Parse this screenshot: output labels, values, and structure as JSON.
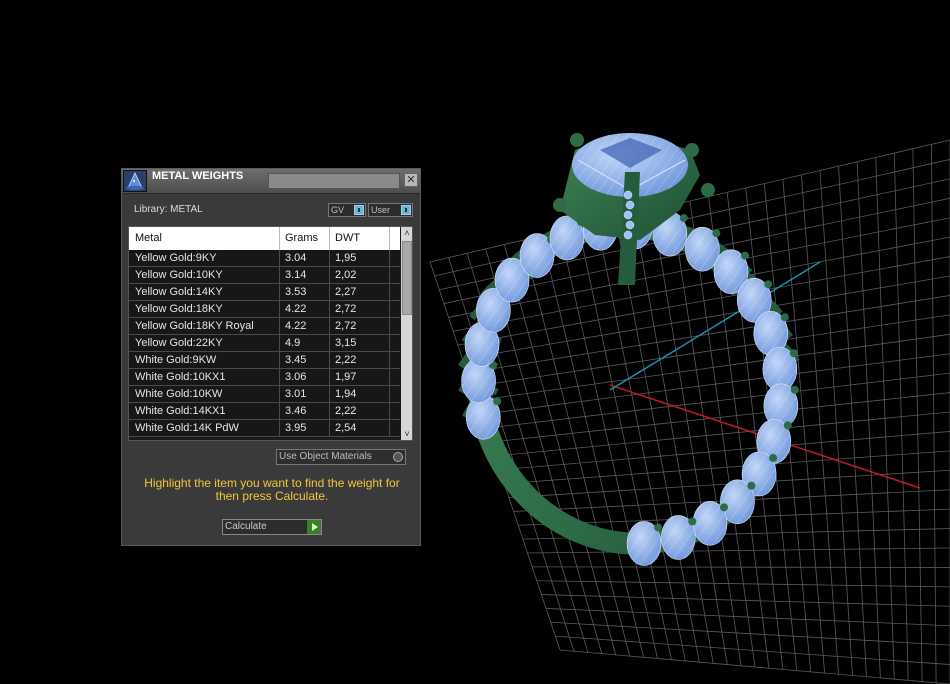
{
  "panel": {
    "title": "METAL WEIGHTS",
    "close_label": "✕",
    "library_label": "Library: METAL",
    "toggle_gv": "GV",
    "toggle_user": "User",
    "columns": [
      "Metal",
      "Grams",
      "DWT"
    ],
    "rows": [
      {
        "metal": "Yellow Gold:9KY",
        "grams": "3.04",
        "dwt": "1,95"
      },
      {
        "metal": "Yellow Gold:10KY",
        "grams": "3.14",
        "dwt": "2,02"
      },
      {
        "metal": "Yellow Gold:14KY",
        "grams": "3.53",
        "dwt": "2,27"
      },
      {
        "metal": "Yellow Gold:18KY",
        "grams": "4.22",
        "dwt": "2,72"
      },
      {
        "metal": "Yellow Gold:18KY Royal",
        "grams": "4.22",
        "dwt": "2,72"
      },
      {
        "metal": "Yellow Gold:22KY",
        "grams": "4.9",
        "dwt": "3,15"
      },
      {
        "metal": "White Gold:9KW",
        "grams": "3.45",
        "dwt": "2,22"
      },
      {
        "metal": "White Gold:10KX1",
        "grams": "3.06",
        "dwt": "1,97"
      },
      {
        "metal": "White Gold:10KW",
        "grams": "3.01",
        "dwt": "1,94"
      },
      {
        "metal": "White Gold:14KX1",
        "grams": "3.46",
        "dwt": "2,22"
      },
      {
        "metal": "White Gold:14K PdW",
        "grams": "3.95",
        "dwt": "2,54"
      }
    ],
    "use_object_materials": "Use Object Materials",
    "hint": "Highlight the item you want to find the weight for then press Calculate.",
    "calculate_label": "Calculate",
    "scroll_up": "˄",
    "scroll_down": "˅"
  },
  "colors": {
    "ring_metal": "#2e6b47",
    "gems": "#8fb4ee",
    "grid": "#5a5a5a",
    "hint_text": "#f2c83a"
  },
  "icons": {
    "title": "wizard-hat-icon",
    "close": "close-icon",
    "calculate": "play-icon"
  }
}
